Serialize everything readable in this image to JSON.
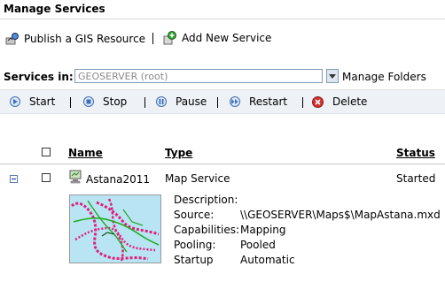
{
  "page": {
    "title": "Manage Services"
  },
  "actions": {
    "publish": "Publish a GIS Resource",
    "add": "Add New Service"
  },
  "services_in": {
    "label": "Services in:",
    "value": "GEOSERVER (root)",
    "manage_folders": "Manage Folders"
  },
  "toolbar": {
    "start": "Start",
    "stop": "Stop",
    "pause": "Pause",
    "restart": "Restart",
    "delete": "Delete"
  },
  "table": {
    "headers": {
      "name": "Name",
      "type": "Type",
      "status": "Status"
    },
    "rows": [
      {
        "name": "Astana2011",
        "type": "Map Service",
        "status": "Started",
        "details": {
          "description_label": "Description:",
          "description_value": "",
          "source_label": "Source:",
          "source_value": "\\\\GEOSERVER\\Maps$\\MapAstana.mxd",
          "capabilities_label": "Capabilities:",
          "capabilities_value": "Mapping",
          "pooling_label": "Pooling:",
          "pooling_value": "Pooled",
          "startup_label": "Startup",
          "startup_value": "Automatic"
        }
      }
    ]
  },
  "icons": {
    "publish": "publish-icon",
    "add": "add-service-icon",
    "start": "start-icon",
    "stop": "stop-icon",
    "pause": "pause-icon",
    "restart": "restart-icon",
    "delete": "delete-icon",
    "collapse": "collapse-icon",
    "service": "map-service-icon"
  },
  "colors": {
    "toolbar_bg": "#eef1f5",
    "icon_blue": "#3f6fb6",
    "delete_red": "#d03030",
    "map_water": "#b8e4f4",
    "map_roads": "#e0207a",
    "map_green": "#22aa22"
  }
}
